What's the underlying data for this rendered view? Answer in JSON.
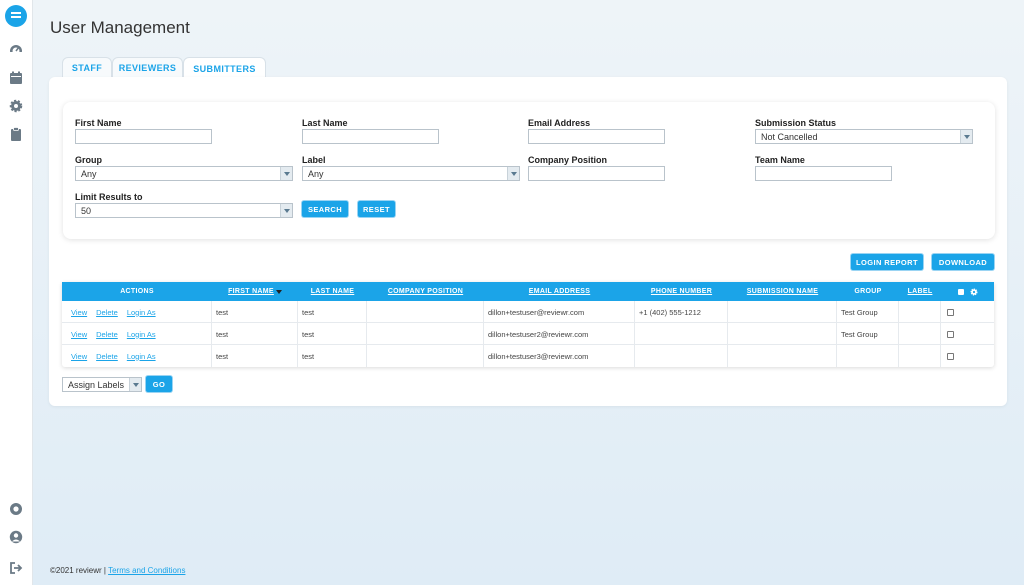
{
  "app": {
    "title": "User Management"
  },
  "sidebar": {
    "icons": [
      "logo-icon",
      "dashboard-icon",
      "calendar-icon",
      "gear-icon",
      "clipboard-icon",
      "help-icon",
      "user-icon",
      "logout-icon"
    ]
  },
  "tabs": [
    {
      "label": "STAFF",
      "active": false
    },
    {
      "label": "REVIEWERS",
      "active": false
    },
    {
      "label": "SUBMITTERS",
      "active": true
    }
  ],
  "filters": {
    "first_name": {
      "label": "First Name",
      "value": ""
    },
    "last_name": {
      "label": "Last Name",
      "value": ""
    },
    "email": {
      "label": "Email Address",
      "value": ""
    },
    "submission_status": {
      "label": "Submission Status",
      "value": "Not Cancelled"
    },
    "group": {
      "label": "Group",
      "value": "Any"
    },
    "label": {
      "label": "Label",
      "value": "Any"
    },
    "company_position": {
      "label": "Company Position",
      "value": ""
    },
    "team_name": {
      "label": "Team Name",
      "value": ""
    },
    "limit": {
      "label": "Limit Results to",
      "value": "50"
    },
    "search_button": "SEARCH",
    "reset_button": "RESET"
  },
  "actions": {
    "login_report": "LOGIN REPORT",
    "download": "DOWNLOAD"
  },
  "table": {
    "columns": [
      "ACTIONS",
      "FIRST NAME",
      "LAST NAME",
      "COMPANY POSITION",
      "EMAIL ADDRESS",
      "PHONE NUMBER",
      "SUBMISSION NAME",
      "GROUP",
      "LABEL"
    ],
    "row_actions": [
      "View",
      "Delete",
      "Login As"
    ],
    "rows": [
      {
        "first": "test",
        "last": "test",
        "position": "",
        "email": "dillon+testuser@reviewr.com",
        "phone": "+1 (402) 555-1212",
        "submission": "",
        "group": "Test Group",
        "label": ""
      },
      {
        "first": "test",
        "last": "test",
        "position": "",
        "email": "dillon+testuser2@reviewr.com",
        "phone": "",
        "submission": "",
        "group": "Test Group",
        "label": ""
      },
      {
        "first": "test",
        "last": "test",
        "position": "",
        "email": "dillon+testuser3@reviewr.com",
        "phone": "",
        "submission": "",
        "group": "",
        "label": ""
      }
    ]
  },
  "bulk": {
    "select_value": "Assign Labels",
    "go_button": "GO"
  },
  "footer": {
    "copyright": "©2021 reviewr |",
    "terms_link": "Terms and Conditions"
  },
  "colors": {
    "accent": "#1ba4e8"
  }
}
